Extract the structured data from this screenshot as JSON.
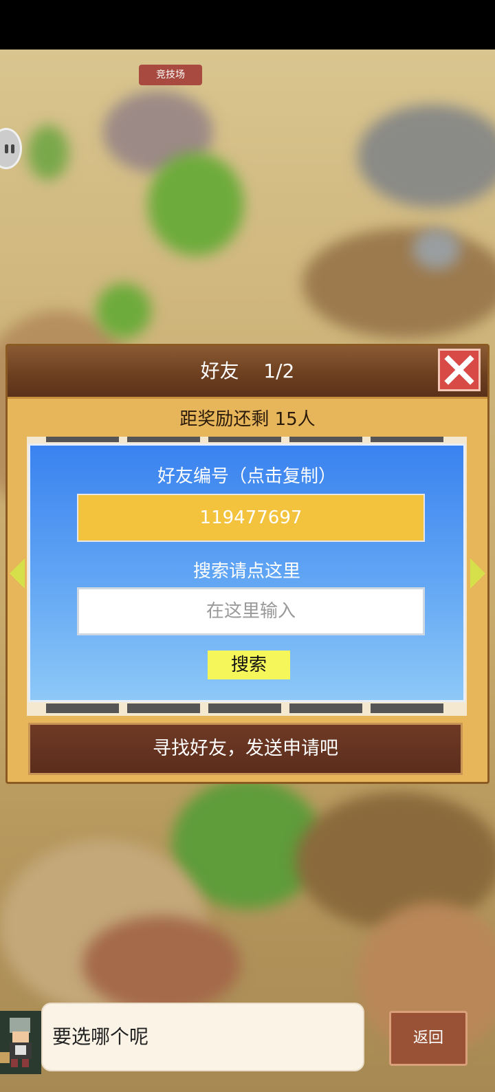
{
  "map": {
    "building_label": "竞技场"
  },
  "dialog": {
    "title": "好友    1/2",
    "reward_text": "距奖励还剩 15人",
    "friend_id_label": "好友编号（点击复制）",
    "friend_id_value": "119477697",
    "search_label": "搜索请点这里",
    "search_placeholder": "在这里输入",
    "search_button": "搜索",
    "hint": "寻找好友，发送申请吧"
  },
  "bottom": {
    "speech": "要选哪个呢",
    "back_button": "返回"
  },
  "colors": {
    "header": "#6b3e1f",
    "panel_top": "#3a82ef",
    "id_box": "#f3c33e",
    "search_btn": "#f4f65a",
    "close": "#d84a45"
  }
}
